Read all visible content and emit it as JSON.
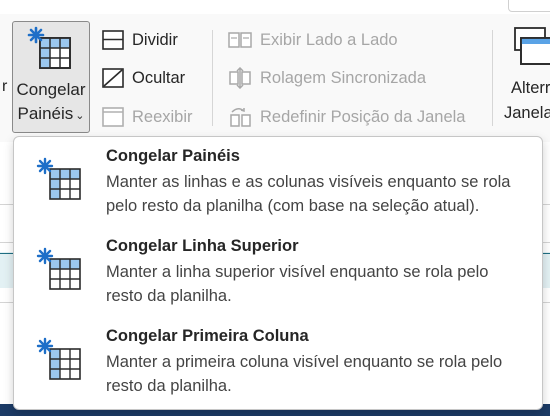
{
  "ribbon": {
    "left_fragment": "r",
    "freeze_panes": {
      "line1": "Congelar",
      "line2": "Painéis",
      "chevron": "⌄"
    },
    "split": "Dividir",
    "hide": "Ocultar",
    "unhide": "Reexibir",
    "view_side_by_side": "Exibir Lado a Lado",
    "synchronous_scrolling": "Rolagem Sincronizada",
    "reset_window_position": "Redefinir Posição da Janela",
    "switch_windows": {
      "line1": "Alterr",
      "line2": "Janela"
    }
  },
  "menu": {
    "items": [
      {
        "title": "Congelar Painéis",
        "line1": "Manter as linhas e as colunas visíveis enquanto se rola",
        "line2": "pelo resto da planilha (com base na seleção atual).",
        "icon": "freeze-panes-icon"
      },
      {
        "title": "Congelar Linha Superior",
        "line1": "Manter a linha superior visível enquanto se rola pelo",
        "line2": "resto da planilha.",
        "icon": "freeze-top-row-icon"
      },
      {
        "title": "Congelar Primeira Coluna",
        "line1": "Manter a primeira coluna visível enquanto se rola pelo",
        "line2": "resto da planilha.",
        "icon": "freeze-first-column-icon"
      }
    ]
  },
  "colors": {
    "accent_blue": "#2e86de",
    "header_teal": "#1f6f83",
    "bottom_navy": "#1c3b66"
  }
}
